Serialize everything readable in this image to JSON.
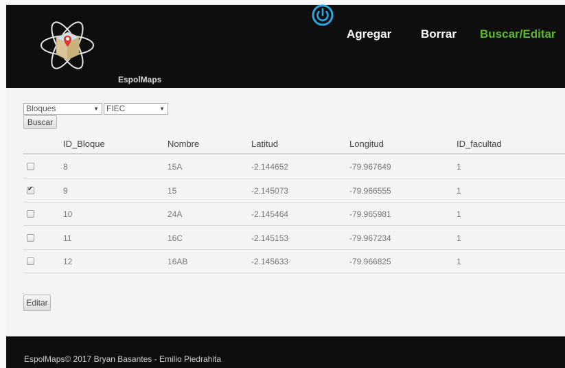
{
  "header": {
    "brand": "EspolMaps",
    "nav": {
      "add": "Agregar",
      "delete": "Borrar",
      "search_edit": "Buscar/Editar"
    },
    "nav_active_color": "#5cb82e",
    "power_color": "#2aa7e0"
  },
  "filters": {
    "type_value": "Bloques",
    "faculty_value": "FIEC",
    "search_label": "Buscar"
  },
  "table": {
    "headers": [
      "ID_Bloque",
      "Nombre",
      "Latitud",
      "Longitud",
      "ID_facultad"
    ],
    "rows": [
      {
        "checked": false,
        "id": "8",
        "name": "15A",
        "lat": "-2.144652",
        "lng": "-79.967649",
        "fac": "1"
      },
      {
        "checked": true,
        "id": "9",
        "name": "15",
        "lat": "-2.145073",
        "lng": "-79.966555",
        "fac": "1"
      },
      {
        "checked": false,
        "id": "10",
        "name": "24A",
        "lat": "-2.145464",
        "lng": "-79.965981",
        "fac": "1"
      },
      {
        "checked": false,
        "id": "11",
        "name": "16C",
        "lat": "-2.145153",
        "lng": "-79.967234",
        "fac": "1"
      },
      {
        "checked": false,
        "id": "12",
        "name": "16AB",
        "lat": "-2.145633",
        "lng": "-79.966825",
        "fac": "1"
      }
    ]
  },
  "actions": {
    "edit_label": "Editar"
  },
  "footer": {
    "text": "EspolMaps© 2017 Bryan Basantes - Emilio Piedrahita"
  }
}
